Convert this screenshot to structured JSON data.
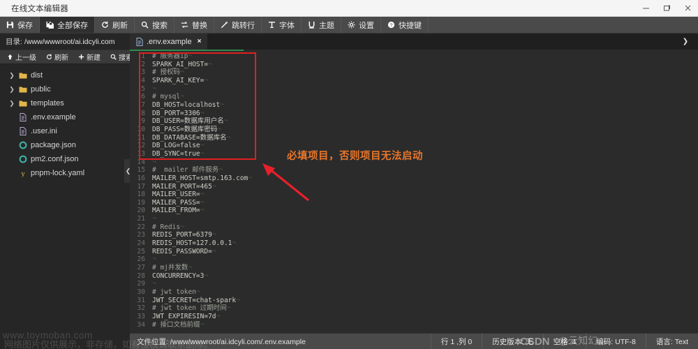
{
  "window": {
    "title": "在线文本编辑器",
    "controls": {
      "minimize": "minimize-icon",
      "maximize": "maximize-icon",
      "close": "close-icon"
    }
  },
  "toolbar": {
    "items": [
      {
        "label": "保存",
        "icon": "save-icon"
      },
      {
        "label": "全部保存",
        "icon": "save-all-icon",
        "active": true
      },
      {
        "label": "刷新",
        "icon": "refresh-icon"
      },
      {
        "label": "搜索",
        "icon": "search-icon"
      },
      {
        "label": "替换",
        "icon": "replace-icon"
      },
      {
        "label": "跳转行",
        "icon": "goto-line-icon"
      },
      {
        "label": "字体",
        "icon": "font-icon"
      },
      {
        "label": "主题",
        "icon": "theme-icon"
      },
      {
        "label": "设置",
        "icon": "gear-icon"
      },
      {
        "label": "快捷键",
        "icon": "help-icon"
      }
    ]
  },
  "sidebar": {
    "dir_label": "目录:",
    "dir_path": "/www/wwwroot/ai.idcyli.com",
    "actions": [
      {
        "label": "上一级",
        "icon": "arrow-up-icon"
      },
      {
        "label": "刷新",
        "icon": "refresh-icon"
      },
      {
        "label": "新建",
        "icon": "plus-icon"
      },
      {
        "label": "搜索",
        "icon": "search-icon"
      }
    ],
    "tree": [
      {
        "name": "dist",
        "type": "folder"
      },
      {
        "name": "public",
        "type": "folder"
      },
      {
        "name": "templates",
        "type": "folder"
      },
      {
        "name": ".env.example",
        "type": "file"
      },
      {
        "name": ".user.ini",
        "type": "file"
      },
      {
        "name": "package.json",
        "type": "json"
      },
      {
        "name": "pm2.conf.json",
        "type": "json"
      },
      {
        "name": "pnpm-lock.yaml",
        "type": "yaml"
      }
    ],
    "collapse_icon": "chevron-left-icon"
  },
  "editor": {
    "tab": {
      "label": ".env.example",
      "icon": "file-icon",
      "close": "×"
    },
    "tab_menu_icon": "chevron-down-icon",
    "progress_percent": 20,
    "annotation": {
      "text": "必填项目，否则项目无法启动",
      "color": "#e8762a",
      "arrow_color": "#e8202a"
    },
    "highlight_box_color": "#e02020",
    "lines": [
      {
        "n": 1,
        "text": "# 服务器ip",
        "comment": true
      },
      {
        "n": 2,
        "text": "SPARK_AI_HOST="
      },
      {
        "n": 3,
        "text": "# 授权码",
        "comment": true
      },
      {
        "n": 4,
        "text": "SPARK_AI_KEY="
      },
      {
        "n": 5,
        "text": ""
      },
      {
        "n": 6,
        "text": "# mysql",
        "comment": true
      },
      {
        "n": 7,
        "text": "DB_HOST=localhost"
      },
      {
        "n": 8,
        "text": "DB_PORT=3306"
      },
      {
        "n": 9,
        "text": "DB_USER=数据库用户名"
      },
      {
        "n": 10,
        "text": "DB_PASS=数据库密码"
      },
      {
        "n": 11,
        "text": "DB_DATABASE=数据库名"
      },
      {
        "n": 12,
        "text": "DB_LOG=false"
      },
      {
        "n": 13,
        "text": "DB_SYNC=true"
      },
      {
        "n": 14,
        "text": ""
      },
      {
        "n": 15,
        "text": "#  mailer 邮件服务",
        "comment": true
      },
      {
        "n": 16,
        "text": "MAILER_HOST=smtp.163.com"
      },
      {
        "n": 17,
        "text": "MAILER_PORT=465"
      },
      {
        "n": 18,
        "text": "MAILER_USER="
      },
      {
        "n": 19,
        "text": "MAILER_PASS="
      },
      {
        "n": 20,
        "text": "MAILER_FROM="
      },
      {
        "n": 21,
        "text": ""
      },
      {
        "n": 22,
        "text": "# Redis",
        "comment": true
      },
      {
        "n": 23,
        "text": "REDIS_PORT=6379"
      },
      {
        "n": 24,
        "text": "REDIS_HOST=127.0.0.1"
      },
      {
        "n": 25,
        "text": "REDIS_PASSWORD="
      },
      {
        "n": 26,
        "text": ""
      },
      {
        "n": 27,
        "text": "# mj并发数",
        "comment": true
      },
      {
        "n": 28,
        "text": "CONCURRENCY=3"
      },
      {
        "n": 29,
        "text": ""
      },
      {
        "n": 30,
        "text": "# jwt token",
        "comment": true
      },
      {
        "n": 31,
        "text": "JWT_SECRET=chat-spark"
      },
      {
        "n": 32,
        "text": "# jwt token 过期时间",
        "comment": true
      },
      {
        "n": 33,
        "text": "JWT_EXPIRESIN=7d"
      },
      {
        "n": 34,
        "text": "# 接口文档前缀",
        "comment": true
      }
    ]
  },
  "statusbar": {
    "file_label": "文件位置:",
    "file_path": "/www/wwwroot/ai.idcyli.com/.env.example",
    "items": [
      "行 1 ,列 0",
      "历史版本: 无",
      "空格: 4",
      "编码: UTF-8",
      "语言: Text"
    ]
  },
  "watermarks": {
    "site": "www.toymoban.com",
    "notice": "网络图片仅供展示，非存储，如有侵权请联系删除。",
    "csdn": "CSDN",
    "author": "@云知幻"
  }
}
